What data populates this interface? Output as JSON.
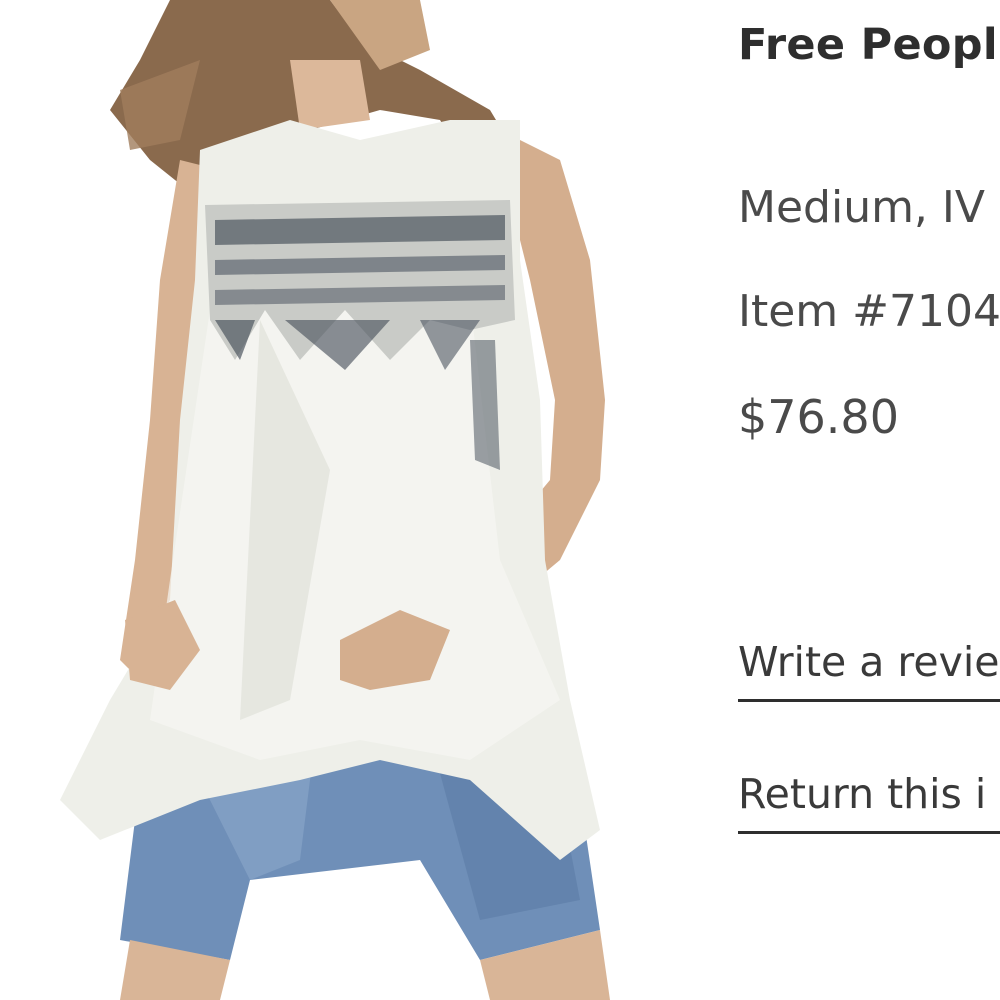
{
  "product": {
    "brand": "Free Peopl",
    "variant": "Medium, IV",
    "item_number": "Item #7104",
    "price": "$76.80",
    "image_icon": "product-photo"
  },
  "actions": {
    "write_review_label": "Write a revie",
    "return_item_label": "Return this i"
  },
  "colors": {
    "text": "#3a3a3a",
    "underline": "#2e2e2e",
    "background": "#ffffff",
    "garment": "#eeefe9",
    "embroidery": "#4d5560",
    "denim": "#6f8fb8"
  }
}
